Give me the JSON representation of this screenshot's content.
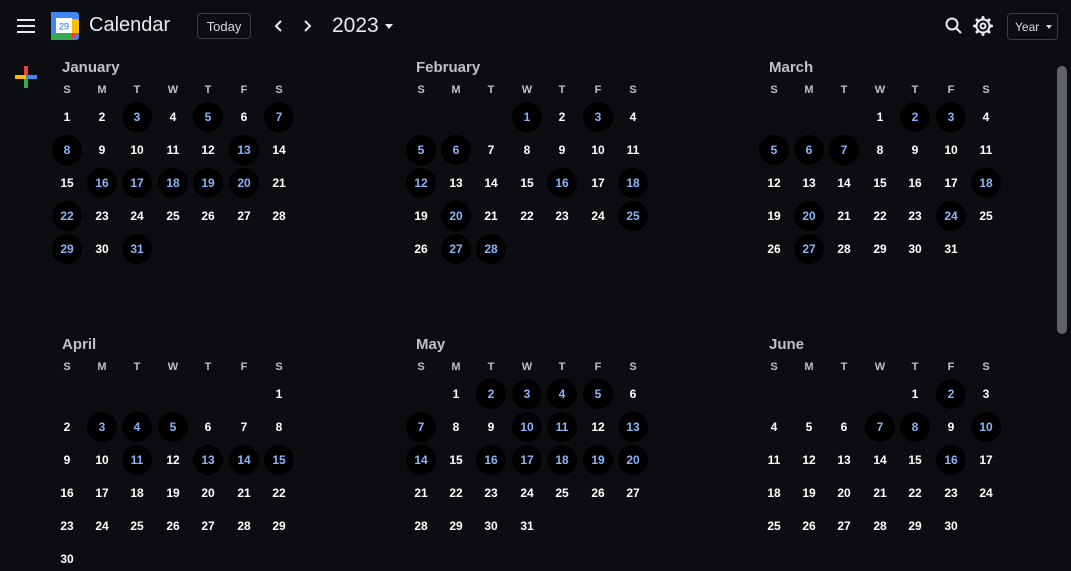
{
  "header": {
    "app_title": "Calendar",
    "logo_day": "29",
    "today_label": "Today",
    "year_label": "2023",
    "view_label": "Year",
    "icons": [
      "menu-icon",
      "calendar-logo-icon",
      "chevron-left-icon",
      "chevron-right-icon",
      "search-icon",
      "gear-icon",
      "plus-icon"
    ]
  },
  "colors": {
    "background": "#0c0d10",
    "event_day": "#8ab4f8",
    "day": "#ffffff",
    "muted": "#bdc1c6"
  },
  "weekday_letters": [
    "S",
    "M",
    "T",
    "W",
    "T",
    "F",
    "S"
  ],
  "months": [
    {
      "name": "January",
      "start": 0,
      "days": 31,
      "event_days": [
        3,
        5,
        7,
        8,
        13,
        16,
        17,
        18,
        19,
        20,
        22,
        29,
        31
      ]
    },
    {
      "name": "February",
      "start": 3,
      "days": 28,
      "event_days": [
        1,
        3,
        5,
        6,
        12,
        16,
        18,
        20,
        25,
        27,
        28
      ]
    },
    {
      "name": "March",
      "start": 3,
      "days": 31,
      "event_days": [
        2,
        3,
        5,
        6,
        7,
        18,
        20,
        24,
        27
      ]
    },
    {
      "name": "April",
      "start": 6,
      "days": 30,
      "event_days": [
        3,
        4,
        5,
        11,
        13,
        14,
        15
      ]
    },
    {
      "name": "May",
      "start": 1,
      "days": 31,
      "event_days": [
        2,
        3,
        4,
        5,
        7,
        10,
        11,
        13,
        14,
        16,
        17,
        18,
        19,
        20
      ]
    },
    {
      "name": "June",
      "start": 4,
      "days": 30,
      "event_days": [
        2,
        7,
        8,
        10,
        16
      ]
    }
  ]
}
